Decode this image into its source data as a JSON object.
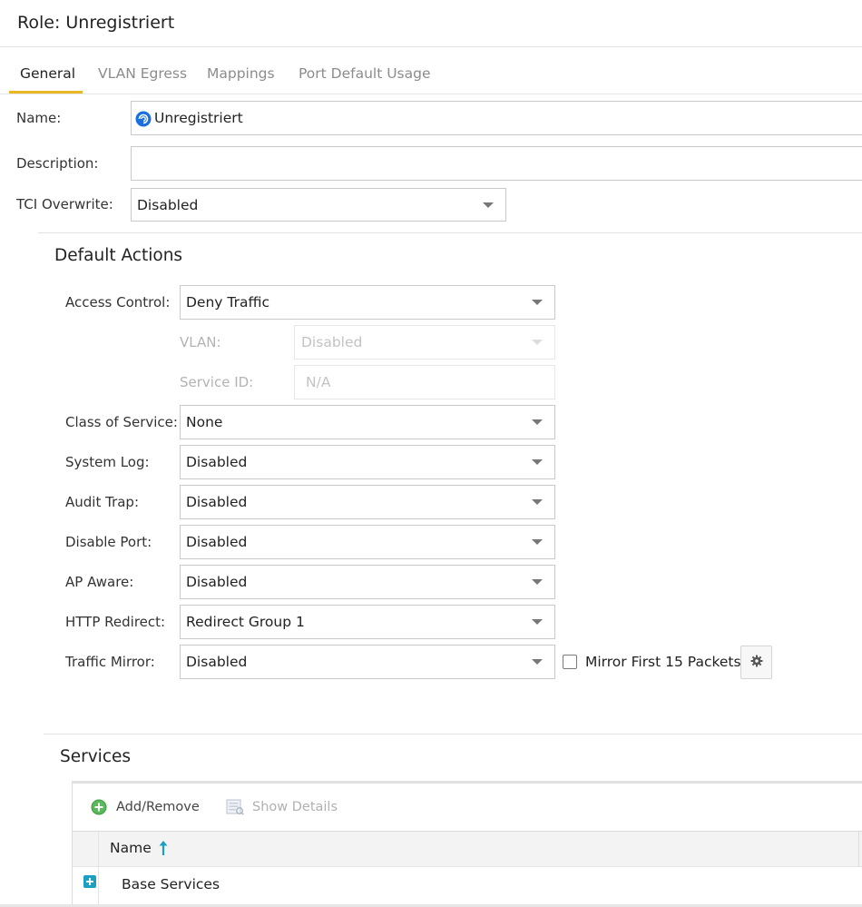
{
  "window": {
    "title": "Role: Unregistriert"
  },
  "tabs": [
    {
      "label": "General",
      "active": true
    },
    {
      "label": "VLAN Egress",
      "active": false
    },
    {
      "label": "Mappings",
      "active": false
    },
    {
      "label": "Port Default Usage",
      "active": false
    }
  ],
  "general": {
    "name_label": "Name:",
    "name_value": "Unregistriert",
    "description_label": "Description:",
    "description_value": "",
    "tci_label": "TCI Overwrite:",
    "tci_value": "Disabled"
  },
  "default_actions": {
    "title": "Default Actions",
    "access_control_label": "Access Control:",
    "access_control_value": "Deny Traffic",
    "vlan_label": "VLAN:",
    "vlan_value": "Disabled",
    "service_id_label": "Service ID:",
    "service_id_value": "N/A",
    "class_of_service_label": "Class of Service:",
    "class_of_service_value": "None",
    "system_log_label": "System Log:",
    "system_log_value": "Disabled",
    "audit_trap_label": "Audit Trap:",
    "audit_trap_value": "Disabled",
    "disable_port_label": "Disable Port:",
    "disable_port_value": "Disabled",
    "ap_aware_label": "AP Aware:",
    "ap_aware_value": "Disabled",
    "http_redirect_label": "HTTP Redirect:",
    "http_redirect_value": "Redirect Group 1",
    "traffic_mirror_label": "Traffic Mirror:",
    "traffic_mirror_value": "Disabled",
    "mirror_first_label": "Mirror First 15 Packets",
    "mirror_first_checked": false
  },
  "services": {
    "title": "Services",
    "toolbar": {
      "add_remove": "Add/Remove",
      "show_details": "Show Details"
    },
    "columns": [
      {
        "label": "Name",
        "sort": "ascending"
      }
    ],
    "rows": [
      {
        "name": "Base Services"
      }
    ]
  },
  "colors": {
    "tab_accent": "#e9b824",
    "sort_arrow": "#1b9fc3",
    "expander": "#1b9fc3",
    "add_icon": "#5cb85c",
    "name_icon": "#1a6fe0"
  }
}
